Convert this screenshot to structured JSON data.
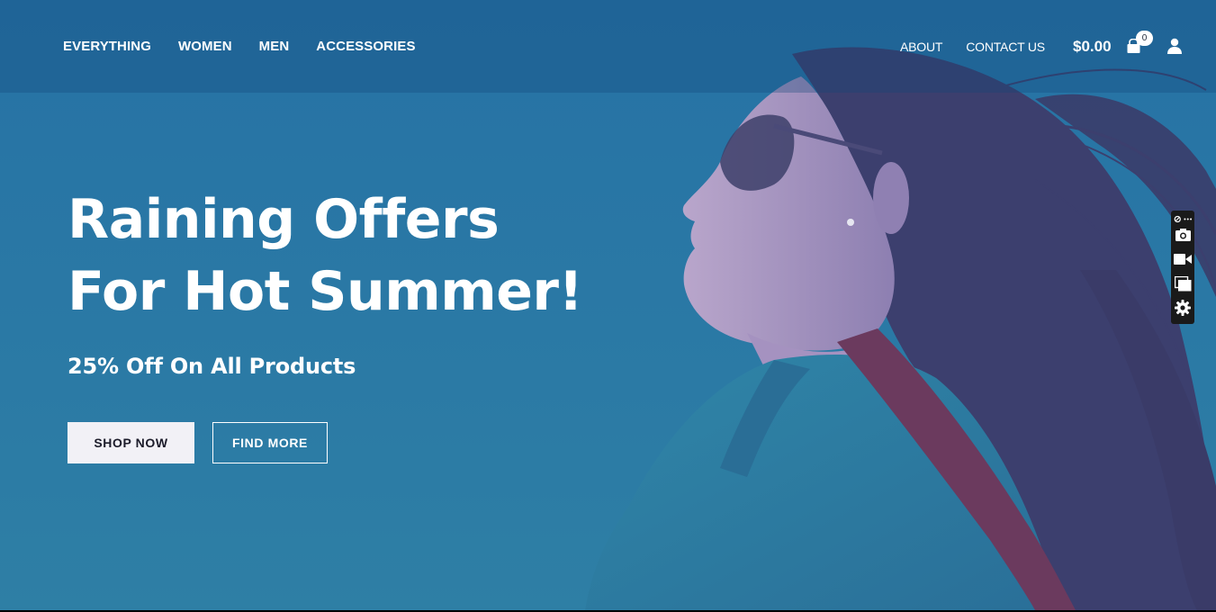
{
  "nav": {
    "primary": [
      "EVERYTHING",
      "WOMEN",
      "MEN",
      "ACCESSORIES"
    ],
    "secondary": [
      "ABOUT",
      "CONTACT US"
    ]
  },
  "cart": {
    "total": "$0.00",
    "count": "0",
    "icon": "cart-icon"
  },
  "account": {
    "icon": "user-icon"
  },
  "hero": {
    "headline_line1": "Raining Offers",
    "headline_line2": "For Hot Summer!",
    "subheadline": "25% Off On All Products",
    "primary_button": "SHOP NOW",
    "secondary_button": "FIND MORE"
  },
  "toolbar": {
    "icons": [
      "pin-icon",
      "more-icon",
      "camera-icon",
      "video-icon",
      "window-icon",
      "gear-icon"
    ]
  },
  "colors": {
    "overlay_blue": "#2674a6",
    "header_overlay": "#1a5a8a",
    "button_light": "#f2f1f6",
    "text_white": "#ffffff"
  }
}
